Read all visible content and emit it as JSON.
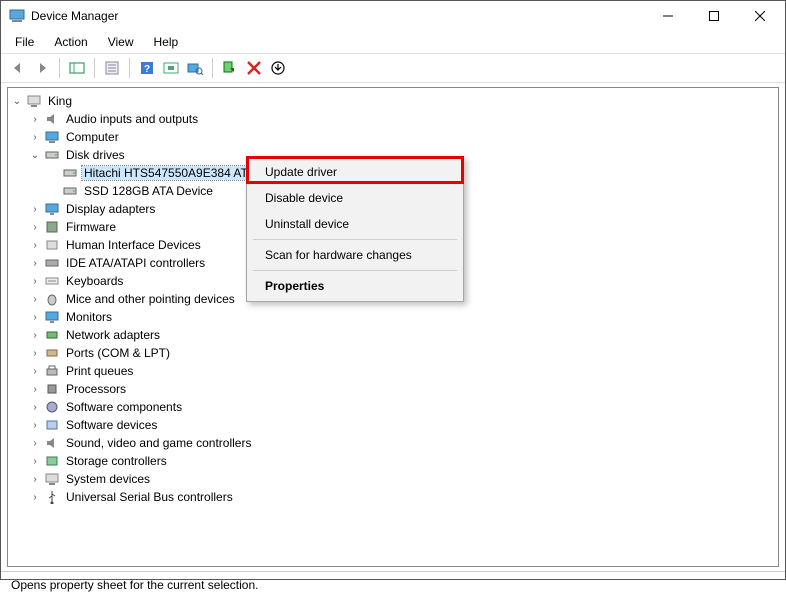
{
  "window": {
    "title": "Device Manager"
  },
  "menus": {
    "file": "File",
    "action": "Action",
    "view": "View",
    "help": "Help"
  },
  "tree": {
    "root": "King",
    "categories": {
      "audio": "Audio inputs and outputs",
      "computer": "Computer",
      "disk": "Disk drives",
      "display": "Display adapters",
      "firmware": "Firmware",
      "hid": "Human Interface Devices",
      "ide": "IDE ATA/ATAPI controllers",
      "keyboards": "Keyboards",
      "mice": "Mice and other pointing devices",
      "monitors": "Monitors",
      "network": "Network adapters",
      "ports": "Ports (COM & LPT)",
      "printqueues": "Print queues",
      "processors": "Processors",
      "softcomp": "Software components",
      "softdev": "Software devices",
      "sound": "Sound, video and game controllers",
      "storage": "Storage controllers",
      "system": "System devices",
      "usb": "Universal Serial Bus controllers"
    },
    "disk_children": {
      "hitachi": "Hitachi HTS547550A9E384 ATA Device",
      "hitachi_truncated": "Hitachi HTS547550A9E384 AT",
      "ssd": "SSD 128GB ATA Device"
    }
  },
  "context_menu": {
    "update": "Update driver",
    "disable": "Disable device",
    "uninstall": "Uninstall device",
    "scan": "Scan for hardware changes",
    "properties": "Properties"
  },
  "statusbar": {
    "text": "Opens property sheet for the current selection."
  }
}
